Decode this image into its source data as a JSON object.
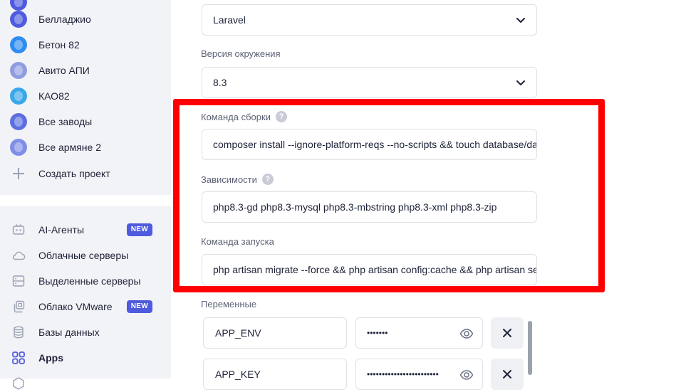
{
  "sidebar": {
    "projects": [
      {
        "label": "Белладжио",
        "color": "#4f5bde"
      },
      {
        "label": "Бетон 82",
        "color": "#2f8cf0"
      },
      {
        "label": "Авито АПИ",
        "color": "#8f9de0"
      },
      {
        "label": "КАО82",
        "color": "#3aa8e8"
      },
      {
        "label": "Все заводы",
        "color": "#5b6fe0"
      },
      {
        "label": "Все армяне 2",
        "color": "#7f8ee6"
      }
    ],
    "create_project": "Создать проект",
    "nav": [
      {
        "label": "AI-Агенты",
        "icon": "robot-icon",
        "badge": "NEW"
      },
      {
        "label": "Облачные серверы",
        "icon": "cloud-icon"
      },
      {
        "label": "Выделенные серверы",
        "icon": "server-icon"
      },
      {
        "label": "Облако VMware",
        "icon": "vmware-icon",
        "badge": "NEW"
      },
      {
        "label": "Базы данных",
        "icon": "database-icon"
      },
      {
        "label": "Apps",
        "icon": "apps-grid-icon",
        "active": true
      }
    ]
  },
  "form": {
    "framework_value": "Laravel",
    "env_version_label": "Версия окружения",
    "env_version_value": "8.3",
    "build_command_label": "Команда сборки",
    "build_command_value": "composer install --ignore-platform-reqs --no-scripts && touch database/database.sqlite",
    "dependencies_label": "Зависимости",
    "dependencies_value": "php8.3-gd php8.3-mysql php8.3-mbstring php8.3-xml php8.3-zip",
    "start_command_label": "Команда запуска",
    "start_command_value": "php artisan migrate --force && php artisan config:cache && php artisan serve",
    "help_glyph": "?",
    "variables_label": "Переменные",
    "variables": [
      {
        "key": "APP_ENV",
        "masked": "•••••••"
      },
      {
        "key": "APP_KEY",
        "masked": "••••••••••••••••••••••••"
      }
    ]
  },
  "colors": {
    "accent": "#4f5bde",
    "highlight": "#ff0000",
    "sidebar_bg": "#f2f3f7"
  }
}
